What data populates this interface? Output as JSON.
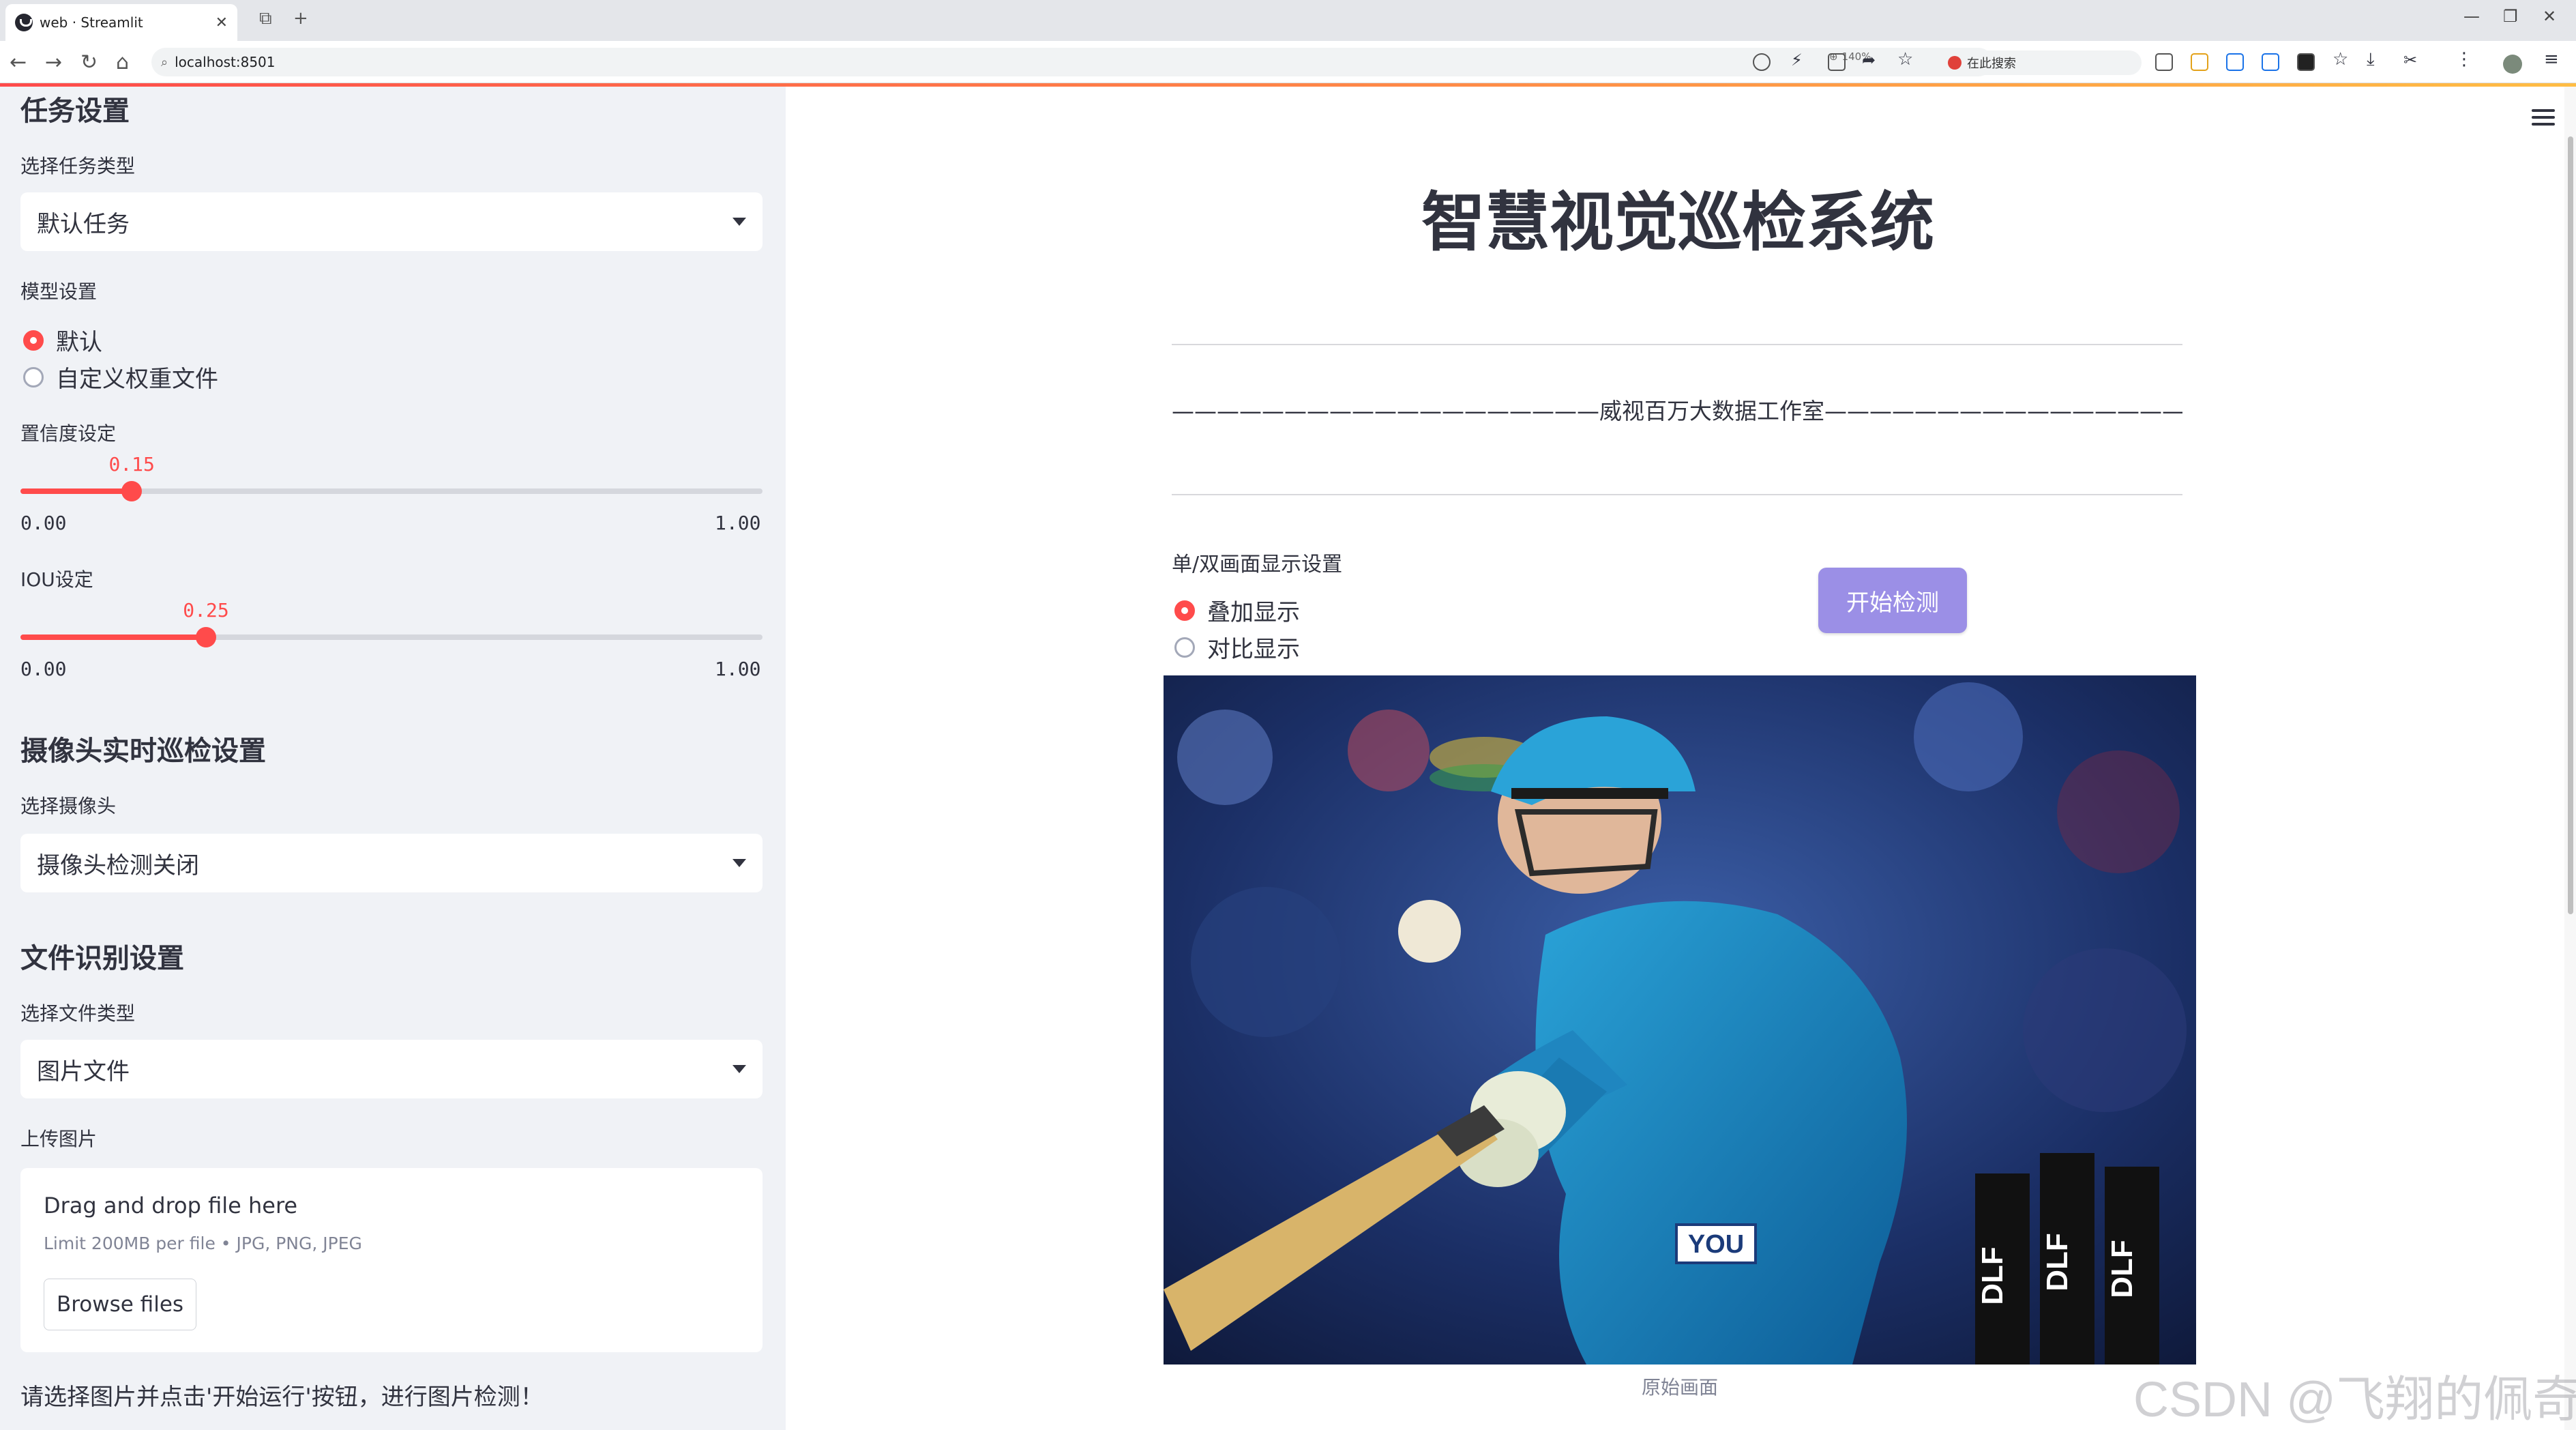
{
  "browser": {
    "tab_title": "web · Streamlit",
    "url": "localhost:8501",
    "zoom": "140%",
    "search_placeholder": "在此搜索"
  },
  "sidebar": {
    "task_heading": "任务设置",
    "task_type_label": "选择任务类型",
    "task_type_value": "默认任务",
    "model_label": "模型设置",
    "model_options": [
      "默认",
      "自定义权重文件"
    ],
    "model_selected": 0,
    "confidence": {
      "label": "置信度设定",
      "value": "0.15",
      "min": "0.00",
      "max": "1.00",
      "fraction": 0.15
    },
    "iou": {
      "label": "IOU设定",
      "value": "0.25",
      "min": "0.00",
      "max": "1.00",
      "fraction": 0.25
    },
    "camera_heading": "摄像头实时巡检设置",
    "camera_label": "选择摄像头",
    "camera_value": "摄像头检测关闭",
    "file_heading": "文件识别设置",
    "file_type_label": "选择文件类型",
    "file_type_value": "图片文件",
    "upload_label": "上传图片",
    "upload_title": "Drag and drop file here",
    "upload_limit": "Limit 200MB per file • JPG, PNG, JPEG",
    "browse_label": "Browse files",
    "note": "请选择图片并点击'开始运行'按钮，进行图片检测！"
  },
  "main": {
    "title": "智慧视觉巡检系统",
    "studio_line": "———————————————————威视百万大数据工作室———————————————————",
    "display_label": "单/双画面显示设置",
    "display_options": [
      "叠加显示",
      "对比显示"
    ],
    "display_selected": 0,
    "start_button": "开始检测",
    "image_caption": "原始画面",
    "image_text": {
      "badge": "YOU",
      "stump_logo": "DLF"
    }
  },
  "watermark": "CSDN @飞翔的佩奇",
  "colors": {
    "accent": "#ff4b4b",
    "button": "#9b8fe6",
    "sidebar_bg": "#f0f2f6"
  }
}
